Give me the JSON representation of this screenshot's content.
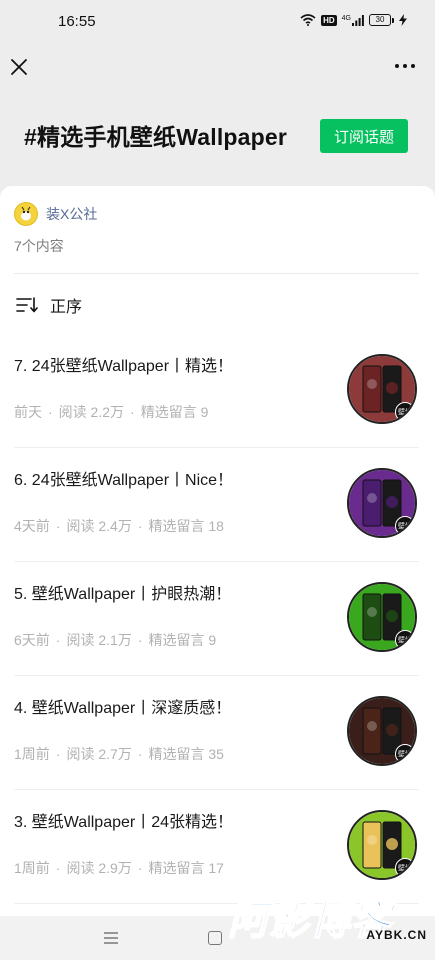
{
  "status_bar": {
    "time": "16:55",
    "hd": "HD",
    "network": "4G",
    "battery": "30",
    "icons": [
      "wifi-icon",
      "signal-icon",
      "battery-icon",
      "bolt-icon"
    ]
  },
  "nav": {
    "close_icon": "close-icon",
    "more_icon": "more-icon"
  },
  "header": {
    "title": "#精选手机壁纸Wallpaper",
    "subscribe_label": "订阅话题"
  },
  "account": {
    "name": "装X公社",
    "count": "7个内容"
  },
  "sort": {
    "label": "正序"
  },
  "articles": [
    {
      "title": "7. 24张壁纸Wallpaper丨精选！",
      "time": "前天",
      "reads": "阅读 2.2万",
      "comments": "精选留言 9",
      "thumb_color": "#6b2324",
      "ring_color": "#8c3a3a",
      "badge": "壁纸"
    },
    {
      "title": "6. 24张壁纸Wallpaper丨Nice！",
      "time": "4天前",
      "reads": "阅读 2.4万",
      "comments": "精选留言 18",
      "thumb_color": "#4a1d6e",
      "ring_color": "#6a2b8f",
      "badge": "壁纸"
    },
    {
      "title": "5. 壁纸Wallpaper丨护眼热潮！",
      "time": "6天前",
      "reads": "阅读 2.1万",
      "comments": "精选留言 9",
      "thumb_color": "#1e4d13",
      "ring_color": "#3aa81e",
      "badge": "壁纸"
    },
    {
      "title": "4. 壁纸Wallpaper丨深邃质感！",
      "time": "1周前",
      "reads": "阅读 2.7万",
      "comments": "精选留言 35",
      "thumb_color": "#4a2418",
      "ring_color": "#3a1e1a",
      "badge": "壁纸"
    },
    {
      "title": "3. 壁纸Wallpaper丨24张精选！",
      "time": "1周前",
      "reads": "阅读 2.9万",
      "comments": "精选留言 17",
      "thumb_color": "#e9c25a",
      "ring_color": "#8ac62a",
      "badge": "壁纸"
    }
  ],
  "meta_separator": "·",
  "watermark": {
    "text": "阿影博客",
    "url": "AYBK.CN"
  },
  "colors": {
    "accent": "#07c160",
    "link": "#576b95",
    "meta": "#b2b2b2"
  }
}
